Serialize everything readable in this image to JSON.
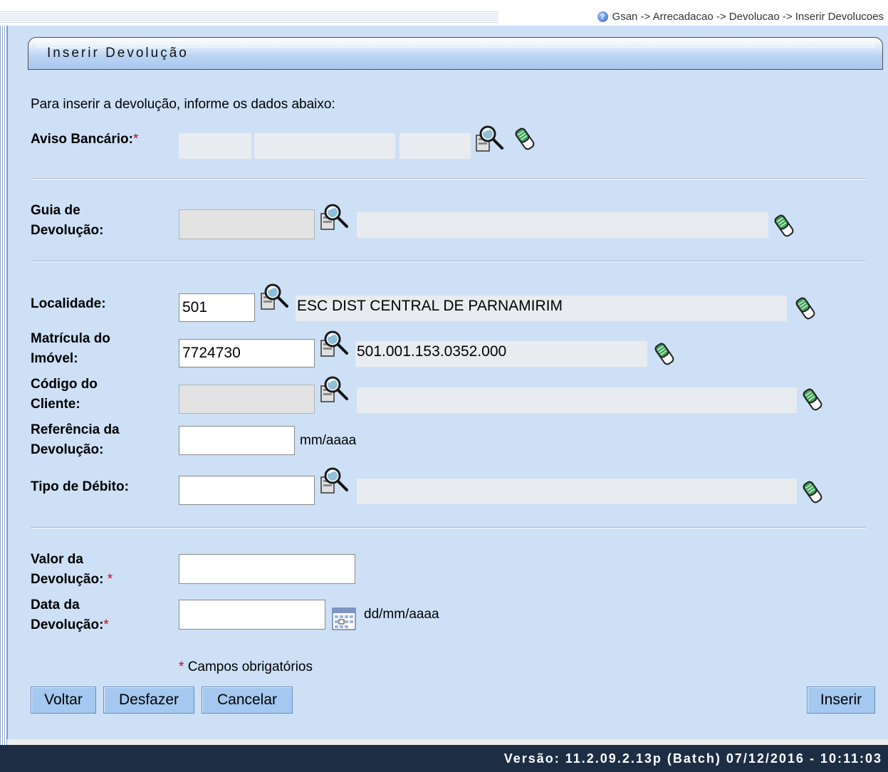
{
  "breadcrumb": "Gsan -> Arrecadacao -> Devolucao -> Inserir Devolucoes",
  "page_title": "Inserir Devolução",
  "intro": "Para inserir a devolução, informe os dados abaixo:",
  "required_mark": "*",
  "fields": {
    "aviso_bancario": {
      "label": "Aviso Bancário:"
    },
    "guia_devolucao": {
      "label_line1": "Guia de",
      "label_line2": "Devolução:"
    },
    "localidade": {
      "label": "Localidade:",
      "value": "501",
      "description": "ESC DIST CENTRAL DE PARNAMIRIM"
    },
    "matricula": {
      "label_line1": "Matrícula do",
      "label_line2": "Imóvel:",
      "value": "7724730",
      "description": "501.001.153.0352.000"
    },
    "codigo_cliente": {
      "label_line1": "Código do",
      "label_line2": "Cliente:"
    },
    "referencia": {
      "label_line1": "Referência da",
      "label_line2": "Devolução:",
      "value": "",
      "hint": "mm/aaaa"
    },
    "tipo_debito": {
      "label": "Tipo de Débito:",
      "value": ""
    },
    "valor": {
      "label_line1": "Valor da",
      "label_line2": "Devolução:",
      "value": ""
    },
    "data": {
      "label_line1": "Data da",
      "label_line2": "Devolução:",
      "value": "",
      "hint": "dd/mm/aaaa"
    }
  },
  "required_note": "Campos obrigatórios",
  "buttons": {
    "voltar": "Voltar",
    "desfazer": "Desfazer",
    "cancelar": "Cancelar",
    "inserir": "Inserir"
  },
  "footer": "Versão: 11.2.09.2.13p (Batch) 07/12/2016 - 10:11:03",
  "colors": {
    "panel_bg": "#cde0f6",
    "button_bg": "#a4c8ef",
    "footer_bg": "#1d2e44",
    "required": "#d0021b"
  },
  "icons": [
    "help-icon",
    "lookup-magnifier-icon",
    "eraser-icon",
    "calendar-icon"
  ]
}
